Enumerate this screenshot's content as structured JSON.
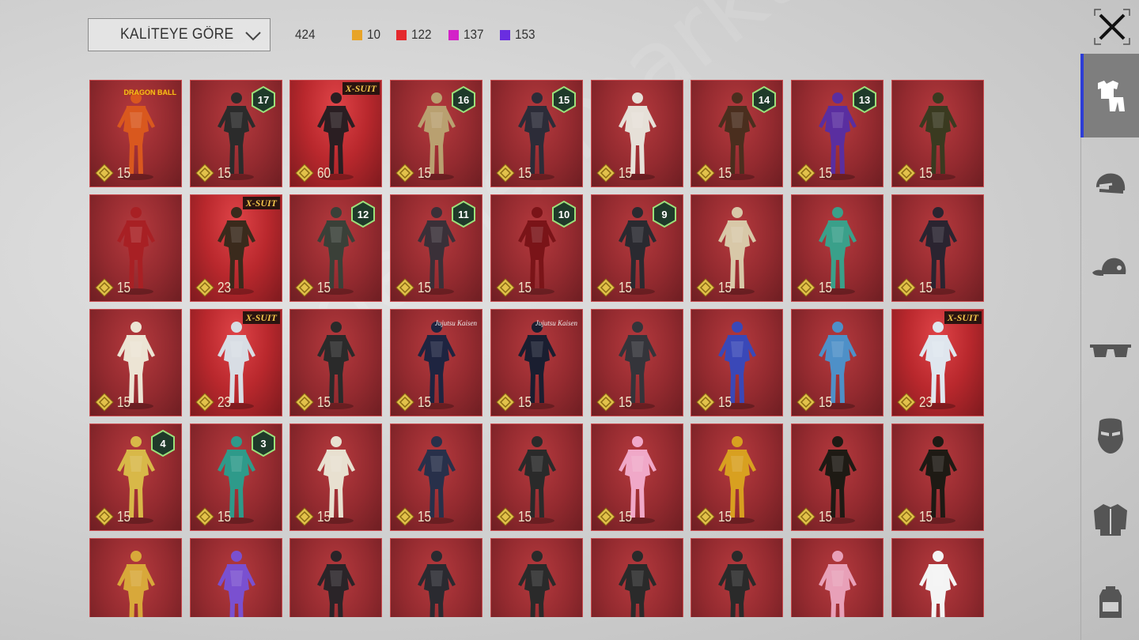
{
  "header": {
    "sort_label": "KALİTEYE GÖRE",
    "total_count": "424",
    "rarity_counts": [
      {
        "count": "10",
        "color": "#e8a428"
      },
      {
        "count": "122",
        "color": "#e4292d"
      },
      {
        "count": "137",
        "color": "#d322c8"
      },
      {
        "count": "153",
        "color": "#6a2ee0"
      }
    ]
  },
  "sidebar": {
    "tabs": [
      {
        "icon": "outfit-icon",
        "active": true
      },
      {
        "icon": "helmet-icon",
        "active": false
      },
      {
        "icon": "cap-icon",
        "active": false
      },
      {
        "icon": "sunglasses-icon",
        "active": false
      },
      {
        "icon": "mask-icon",
        "active": false
      },
      {
        "icon": "jacket-icon",
        "active": false
      },
      {
        "icon": "backpack-icon",
        "active": false
      }
    ]
  },
  "colors": {
    "card_red": "#932a2f",
    "active_tab": "#7e7e7e",
    "active_indicator": "#2d3dd6",
    "price_gold": "#e2c14a"
  },
  "watermark": "gamermarkt.com",
  "items": [
    {
      "price": "15",
      "tag": "DRAGON BALL",
      "tag_type": "brand",
      "outfit": "#d9581e"
    },
    {
      "price": "15",
      "level": "17",
      "outfit": "#2b2b2b"
    },
    {
      "price": "60",
      "tag": "X-SUIT",
      "tag_type": "xsuit",
      "outfit": "#2a1e22"
    },
    {
      "price": "15",
      "level": "16",
      "outfit": "#b9a070"
    },
    {
      "price": "15",
      "level": "15",
      "outfit": "#2c2c38"
    },
    {
      "price": "15",
      "outfit": "#e6e0d8"
    },
    {
      "price": "15",
      "level": "14",
      "outfit": "#4a2e1e"
    },
    {
      "price": "15",
      "level": "13",
      "outfit": "#5a2ea0"
    },
    {
      "price": "15",
      "outfit": "#3a3a20"
    },
    {
      "price": "15",
      "outfit": "#a82024"
    },
    {
      "price": "23",
      "tag": "X-SUIT",
      "tag_type": "xsuit",
      "outfit": "#3a2a1c"
    },
    {
      "price": "15",
      "level": "12",
      "outfit": "#3a4038"
    },
    {
      "price": "15",
      "level": "11",
      "outfit": "#3a3038"
    },
    {
      "price": "15",
      "level": "10",
      "outfit": "#7a1418"
    },
    {
      "price": "15",
      "level": "9",
      "outfit": "#2a2a30"
    },
    {
      "price": "15",
      "outfit": "#d8c8a8"
    },
    {
      "price": "15",
      "outfit": "#3aa08a"
    },
    {
      "price": "15",
      "outfit": "#2a2430"
    },
    {
      "price": "15",
      "outfit": "#ece4d4"
    },
    {
      "price": "23",
      "tag": "X-SUIT",
      "tag_type": "xsuit",
      "outfit": "#d8dde4"
    },
    {
      "price": "15",
      "outfit": "#2a2a2a"
    },
    {
      "price": "15",
      "tag": "Jujutsu Kaisen",
      "tag_type": "script",
      "outfit": "#1e2440"
    },
    {
      "price": "15",
      "tag": "Jujutsu Kaisen",
      "tag_type": "script",
      "outfit": "#1a1e30"
    },
    {
      "price": "15",
      "outfit": "#34343a"
    },
    {
      "price": "15",
      "outfit": "#3a48b8"
    },
    {
      "price": "15",
      "outfit": "#4e90c8"
    },
    {
      "price": "23",
      "tag": "X-SUIT",
      "tag_type": "xsuit",
      "outfit": "#dfe6ee"
    },
    {
      "price": "15",
      "level": "4",
      "outfit": "#d8b848"
    },
    {
      "price": "15",
      "level": "3",
      "outfit": "#2e9a8a"
    },
    {
      "price": "15",
      "outfit": "#e8e0d0"
    },
    {
      "price": "15",
      "outfit": "#28304a"
    },
    {
      "price": "15",
      "outfit": "#2a2a2a"
    },
    {
      "price": "15",
      "outfit": "#f0a8c8"
    },
    {
      "price": "15",
      "outfit": "#d8a020"
    },
    {
      "price": "15",
      "outfit": "#1e1a14"
    },
    {
      "price": "15",
      "outfit": "#1e1a14"
    },
    {
      "price": "",
      "outfit": "#d8a83a"
    },
    {
      "price": "",
      "outfit": "#7a50d0"
    },
    {
      "price": "",
      "outfit": "#2a2428"
    },
    {
      "price": "",
      "outfit": "#2a2a30"
    },
    {
      "price": "",
      "outfit": "#2a2a2a"
    },
    {
      "price": "",
      "outfit": "#2a2a2a"
    },
    {
      "price": "",
      "outfit": "#2a2a2a"
    },
    {
      "price": "",
      "outfit": "#e8a0b8"
    },
    {
      "price": "",
      "outfit": "#f4f4f4"
    }
  ]
}
